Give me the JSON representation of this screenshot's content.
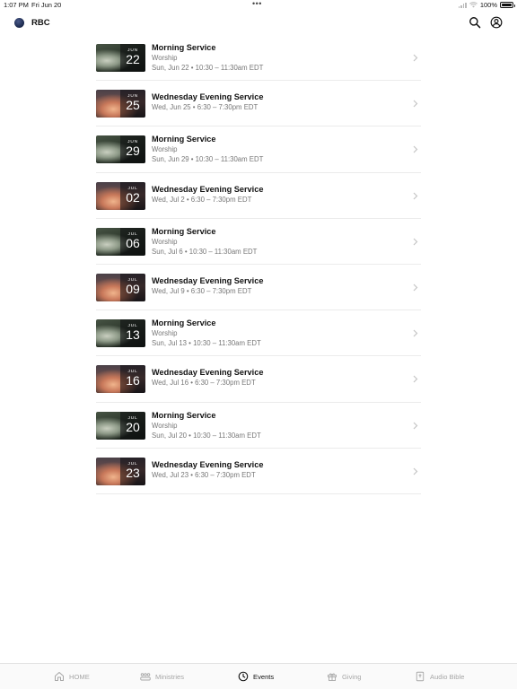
{
  "status_bar": {
    "time": "1:07 PM",
    "date": "Fri Jun 20",
    "battery": "100%"
  },
  "header": {
    "title": "RBC"
  },
  "events": [
    {
      "title": "Morning Service",
      "category": "Worship",
      "when": "Sun, Jun 22 • 10:30 – 11:30am EDT",
      "month": "JUN",
      "day": "22",
      "image": "worship"
    },
    {
      "title": "Wednesday Evening Service",
      "category": "",
      "when": "Wed, Jun 25 • 6:30 – 7:30pm EDT",
      "month": "JUN",
      "day": "25",
      "image": "evening"
    },
    {
      "title": "Morning Service",
      "category": "Worship",
      "when": "Sun, Jun 29 • 10:30 – 11:30am EDT",
      "month": "JUN",
      "day": "29",
      "image": "worship"
    },
    {
      "title": "Wednesday Evening Service",
      "category": "",
      "when": "Wed, Jul 2 • 6:30 – 7:30pm EDT",
      "month": "JUL",
      "day": "02",
      "image": "evening"
    },
    {
      "title": "Morning Service",
      "category": "Worship",
      "when": "Sun, Jul 6 • 10:30 – 11:30am EDT",
      "month": "JUL",
      "day": "06",
      "image": "worship"
    },
    {
      "title": "Wednesday Evening Service",
      "category": "",
      "when": "Wed, Jul 9 • 6:30 – 7:30pm EDT",
      "month": "JUL",
      "day": "09",
      "image": "evening"
    },
    {
      "title": "Morning Service",
      "category": "Worship",
      "when": "Sun, Jul 13 • 10:30 – 11:30am EDT",
      "month": "JUL",
      "day": "13",
      "image": "worship"
    },
    {
      "title": "Wednesday Evening Service",
      "category": "",
      "when": "Wed, Jul 16 • 6:30 – 7:30pm EDT",
      "month": "JUL",
      "day": "16",
      "image": "evening"
    },
    {
      "title": "Morning Service",
      "category": "Worship",
      "when": "Sun, Jul 20 • 10:30 – 11:30am EDT",
      "month": "JUL",
      "day": "20",
      "image": "worship"
    },
    {
      "title": "Wednesday Evening Service",
      "category": "",
      "when": "Wed, Jul 23 • 6:30 – 7:30pm EDT",
      "month": "JUL",
      "day": "23",
      "image": "evening"
    }
  ],
  "tabs": [
    {
      "label": "HOME",
      "icon": "home-icon",
      "active": false
    },
    {
      "label": "Ministries",
      "icon": "people-icon",
      "active": false
    },
    {
      "label": "Events",
      "icon": "clock-icon",
      "active": true
    },
    {
      "label": "Giving",
      "icon": "gift-icon",
      "active": false
    },
    {
      "label": "Audio Bible",
      "icon": "bible-icon",
      "active": false
    }
  ],
  "colors": {
    "active_tab": "#111111",
    "inactive_tab": "#a6a6a6",
    "secondary_text": "#777777"
  }
}
